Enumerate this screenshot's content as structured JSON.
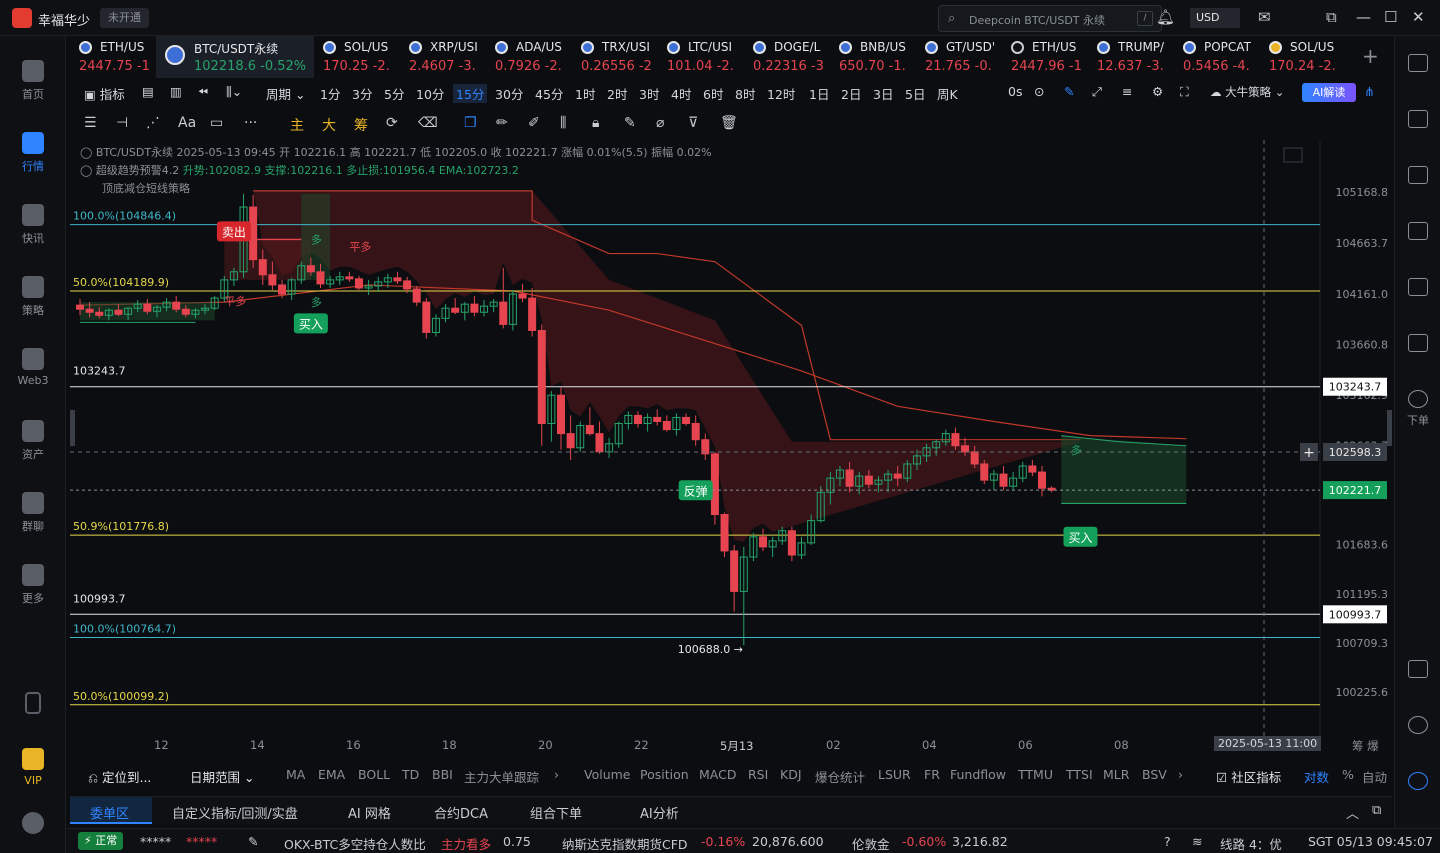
{
  "app": {
    "title": "幸福华少",
    "account_badge": "未开通",
    "currency": "USD"
  },
  "search": {
    "placeholder": "Deepcoin BTC/USDT 永续",
    "shortcut": "/"
  },
  "sidebar": [
    {
      "label": "首页",
      "icon": "home-icon"
    },
    {
      "label": "行情",
      "icon": "market-chart-icon",
      "active": true
    },
    {
      "label": "快讯",
      "icon": "news-icon"
    },
    {
      "label": "策略",
      "icon": "strategy-icon"
    },
    {
      "label": "Web3",
      "icon": "web3-icon"
    },
    {
      "label": "资产",
      "icon": "wallet-icon"
    },
    {
      "label": "群聊",
      "icon": "chat-icon"
    },
    {
      "label": "更多",
      "icon": "more-grid-icon"
    },
    {
      "label": "VIP",
      "icon": "vip-diamond-icon"
    }
  ],
  "tickers": [
    {
      "name": "ETH/US",
      "price": "2447.75",
      "change": "-1"
    },
    {
      "name": "BTC/USDT永续",
      "price": "102218.6",
      "change": "-0.52%",
      "active": true
    },
    {
      "name": "SOL/US",
      "price": "170.25",
      "change": "-2."
    },
    {
      "name": "XRP/USI",
      "price": "2.4607",
      "change": "-3."
    },
    {
      "name": "ADA/US",
      "price": "0.7926",
      "change": "-2."
    },
    {
      "name": "TRX/USI",
      "price": "0.26556",
      "change": "-2"
    },
    {
      "name": "LTC/USI",
      "price": "101.04",
      "change": "-2."
    },
    {
      "name": "DOGE/L",
      "price": "0.22316",
      "change": "-3"
    },
    {
      "name": "BNB/US",
      "price": "650.70",
      "change": "-1."
    },
    {
      "name": "GT/USD'",
      "price": "21.765",
      "change": "-0."
    },
    {
      "name": "ETH/US",
      "price": "2447.96",
      "change": "-1"
    },
    {
      "name": "TRUMP/",
      "price": "12.637",
      "change": "-3."
    },
    {
      "name": "POPCAT",
      "price": "0.5456",
      "change": "-4."
    },
    {
      "name": "SOL/US",
      "price": "170.24",
      "change": "-2."
    }
  ],
  "periodbar": {
    "indicator_label": "指标",
    "period_label": "周期",
    "periods": [
      "1分",
      "3分",
      "5分",
      "10分",
      "15分",
      "30分",
      "45分",
      "1时",
      "2时",
      "3时",
      "4时",
      "6时",
      "8时",
      "12时",
      "1日",
      "2日",
      "3日",
      "5日",
      "周K"
    ],
    "selected": "15分",
    "countdown": "0s",
    "strategy_label": "大牛策略",
    "ai_label": "AI解读"
  },
  "drawbar": {
    "main_label": "主",
    "big_label": "大",
    "chip_label": "筹"
  },
  "chart_info": {
    "line1": "BTC/USDT永续  2025-05-13 09:45  开 102216.1  高 102221.7  低 102205.0  收 102221.7  涨幅 0.01%(5.5)  振幅 0.02%",
    "line2_name": "超级趋势预警4.2",
    "line2_values": "升势:102082.9  支撑:102216.1  多止损:101956.4  EMA:102723.2",
    "line3": "顶底减仓短线策略"
  },
  "chart_data": {
    "type": "candlestick",
    "y_ticks": [
      "105168.8",
      "104663.7",
      "104161.0",
      "103660.8",
      "103162.9",
      "102663.7",
      "101683.6",
      "101195.3",
      "100709.3",
      "100225.6"
    ],
    "fib_levels": [
      {
        "label": "100.0%(104846.4)",
        "value": 104846.4,
        "color": "#3fb6c8"
      },
      {
        "label": "50.0%(104189.9)",
        "value": 104189.9,
        "color": "#e6d84a"
      },
      {
        "label": "50.9%(101776.8)",
        "value": 101776.8,
        "color": "#e6d84a"
      },
      {
        "label": "100.0%(100764.7)",
        "value": 100764.7,
        "color": "#3fb6c8"
      },
      {
        "label": "50.0%(100099.2)",
        "value": 100099.2,
        "color": "#e6d84a"
      }
    ],
    "horizontal_levels": [
      {
        "label": "103243.7",
        "value": 103243.7
      },
      {
        "label": "100993.7",
        "value": 100993.7
      }
    ],
    "current_price": "102221.7",
    "cursor_price": "102598.3",
    "low_marker": "100688.0",
    "signals": [
      {
        "label": "卖出",
        "type": "sell"
      },
      {
        "label": "买入",
        "type": "buy"
      },
      {
        "label": "反弹",
        "type": "rebound"
      },
      {
        "label": "买入",
        "type": "buy"
      }
    ],
    "zone_labels": [
      "平多",
      "平多",
      "多",
      "多",
      "多"
    ],
    "x_labels": [
      "12",
      "14",
      "16",
      "18",
      "20",
      "22",
      "5月13",
      "02",
      "04",
      "06",
      "08"
    ],
    "cursor_time": "2025-05-13 11:00",
    "candles": [
      [
        104050,
        104110,
        103950,
        104010
      ],
      [
        104010,
        104080,
        103930,
        103980
      ],
      [
        103980,
        104030,
        103920,
        103950
      ],
      [
        103950,
        104020,
        103900,
        104000
      ],
      [
        104000,
        104060,
        103940,
        103960
      ],
      [
        103960,
        104030,
        103900,
        104020
      ],
      [
        104020,
        104100,
        103980,
        104060
      ],
      [
        104060,
        104110,
        103960,
        103990
      ],
      [
        103990,
        104050,
        103930,
        104030
      ],
      [
        104030,
        104120,
        103990,
        104080
      ],
      [
        104080,
        104140,
        103980,
        104010
      ],
      [
        104010,
        104050,
        103930,
        103960
      ],
      [
        103960,
        104020,
        103920,
        104000
      ],
      [
        104000,
        104060,
        103960,
        104020
      ],
      [
        104020,
        104140,
        104000,
        104120
      ],
      [
        104120,
        104340,
        104080,
        104300
      ],
      [
        104300,
        104420,
        104240,
        104380
      ],
      [
        104380,
        105150,
        104320,
        105020
      ],
      [
        105020,
        105140,
        104420,
        104500
      ],
      [
        104500,
        104600,
        104250,
        104350
      ],
      [
        104350,
        104480,
        104200,
        104250
      ],
      [
        104250,
        104300,
        104120,
        104160
      ],
      [
        104160,
        104320,
        104100,
        104300
      ],
      [
        104300,
        104480,
        104260,
        104440
      ],
      [
        104440,
        104520,
        104340,
        104380
      ],
      [
        104380,
        104460,
        104220,
        104260
      ],
      [
        104260,
        104340,
        104220,
        104300
      ],
      [
        104300,
        104380,
        104250,
        104330
      ],
      [
        104330,
        104380,
        104280,
        104310
      ],
      [
        104310,
        104340,
        104200,
        104220
      ],
      [
        104220,
        104300,
        104150,
        104240
      ],
      [
        104240,
        104330,
        104180,
        104280
      ],
      [
        104280,
        104360,
        104220,
        104320
      ],
      [
        104320,
        104380,
        104260,
        104290
      ],
      [
        104290,
        104330,
        104170,
        104210
      ],
      [
        104210,
        104240,
        104040,
        104080
      ],
      [
        104080,
        104120,
        103720,
        103780
      ],
      [
        103780,
        103960,
        103740,
        103920
      ],
      [
        103920,
        104060,
        103880,
        104020
      ],
      [
        104020,
        104120,
        103960,
        103980
      ],
      [
        103980,
        104080,
        103900,
        104060
      ],
      [
        104060,
        104140,
        103940,
        103980
      ],
      [
        103980,
        104100,
        103940,
        104040
      ],
      [
        104040,
        104110,
        103980,
        104080
      ],
      [
        104080,
        104420,
        103820,
        103860
      ],
      [
        103860,
        104200,
        103800,
        104160
      ],
      [
        104160,
        104260,
        104080,
        104120
      ],
      [
        104120,
        104220,
        103740,
        103800
      ],
      [
        103800,
        103860,
        102660,
        102880
      ],
      [
        102880,
        103200,
        102700,
        103160
      ],
      [
        103160,
        103240,
        102620,
        102780
      ],
      [
        102780,
        102960,
        102520,
        102640
      ],
      [
        102640,
        102900,
        102600,
        102860
      ],
      [
        102860,
        103040,
        102760,
        102780
      ],
      [
        102780,
        102900,
        102580,
        102600
      ],
      [
        102600,
        102740,
        102540,
        102680
      ],
      [
        102680,
        102900,
        102640,
        102880
      ],
      [
        102880,
        103000,
        102820,
        102960
      ],
      [
        102960,
        103000,
        102840,
        102880
      ],
      [
        102880,
        102980,
        102800,
        102940
      ],
      [
        102940,
        103020,
        102860,
        102900
      ],
      [
        102900,
        102960,
        102800,
        102820
      ],
      [
        102820,
        102980,
        102760,
        102940
      ],
      [
        102940,
        102980,
        102860,
        102880
      ],
      [
        102880,
        102960,
        102660,
        102720
      ],
      [
        102720,
        102780,
        102520,
        102580
      ],
      [
        102580,
        102600,
        101880,
        101980
      ],
      [
        101980,
        102000,
        101560,
        101620
      ],
      [
        101620,
        101680,
        101020,
        101220
      ],
      [
        101220,
        101660,
        100688,
        101560
      ],
      [
        101560,
        101800,
        101520,
        101760
      ],
      [
        101760,
        101840,
        101620,
        101660
      ],
      [
        101660,
        101760,
        101560,
        101720
      ],
      [
        101720,
        101860,
        101680,
        101820
      ],
      [
        101820,
        101860,
        101520,
        101580
      ],
      [
        101580,
        101760,
        101540,
        101700
      ],
      [
        101700,
        101980,
        101680,
        101920
      ],
      [
        101920,
        102260,
        101900,
        102200
      ],
      [
        102200,
        102400,
        102080,
        102340
      ],
      [
        102340,
        102460,
        102260,
        102420
      ],
      [
        102420,
        102500,
        102200,
        102260
      ],
      [
        102260,
        102400,
        102180,
        102360
      ],
      [
        102360,
        102420,
        102240,
        102280
      ],
      [
        102280,
        102360,
        102200,
        102320
      ],
      [
        102320,
        102420,
        102200,
        102380
      ],
      [
        102380,
        102460,
        102260,
        102340
      ],
      [
        102340,
        102520,
        102300,
        102480
      ],
      [
        102480,
        102620,
        102420,
        102560
      ],
      [
        102560,
        102680,
        102500,
        102640
      ],
      [
        102640,
        102720,
        102560,
        102700
      ],
      [
        102700,
        102820,
        102660,
        102780
      ],
      [
        102780,
        102840,
        102620,
        102660
      ],
      [
        102660,
        102740,
        102560,
        102600
      ],
      [
        102600,
        102660,
        102440,
        102480
      ],
      [
        102480,
        102520,
        102280,
        102320
      ],
      [
        102320,
        102420,
        102220,
        102380
      ],
      [
        102380,
        102460,
        102220,
        102260
      ],
      [
        102260,
        102400,
        102220,
        102340
      ],
      [
        102340,
        102500,
        102300,
        102460
      ],
      [
        102460,
        102520,
        102360,
        102400
      ],
      [
        102400,
        102460,
        102160,
        102240
      ],
      [
        102240,
        102260,
        102200,
        102221.7
      ]
    ]
  },
  "time_axis_extra": "筹  爆",
  "indicator_bar": {
    "locate": "定位到...",
    "date_range": "日期范围",
    "items": [
      "MA",
      "EMA",
      "BOLL",
      "TD",
      "BBI",
      "主力大单跟踪",
      "Volume",
      "Position",
      "MACD",
      "RSI",
      "KDJ",
      "爆仓统计",
      "LSUR",
      "FR",
      "Fundflow",
      "TTMU",
      "TTSI",
      "MLR",
      "BSV"
    ],
    "community": "社区指标",
    "log": "对数",
    "pct": "%",
    "auto": "自动"
  },
  "order_tabs": [
    "委单区",
    "自定义指标/回测/实盘",
    "AI 网格",
    "合约DCA",
    "组合下单",
    "AI分析"
  ],
  "status": {
    "net": "正常",
    "masked": "*****",
    "okx_label": "OKX-BTC多空持仓人数比",
    "okx_tag": "主力看多",
    "okx_value": "0.75",
    "nasdaq_label": "纳斯达克指数期货CFD",
    "nasdaq_change": "-0.16%",
    "nasdaq_value": "20,876.600",
    "gold_label": "伦敦金",
    "gold_change": "-0.60%",
    "gold_value": "3,216.82",
    "line": "线路 4：优",
    "time": "SGT 05/13 09:45:07"
  },
  "right_rail": {
    "order_label": "下单"
  }
}
